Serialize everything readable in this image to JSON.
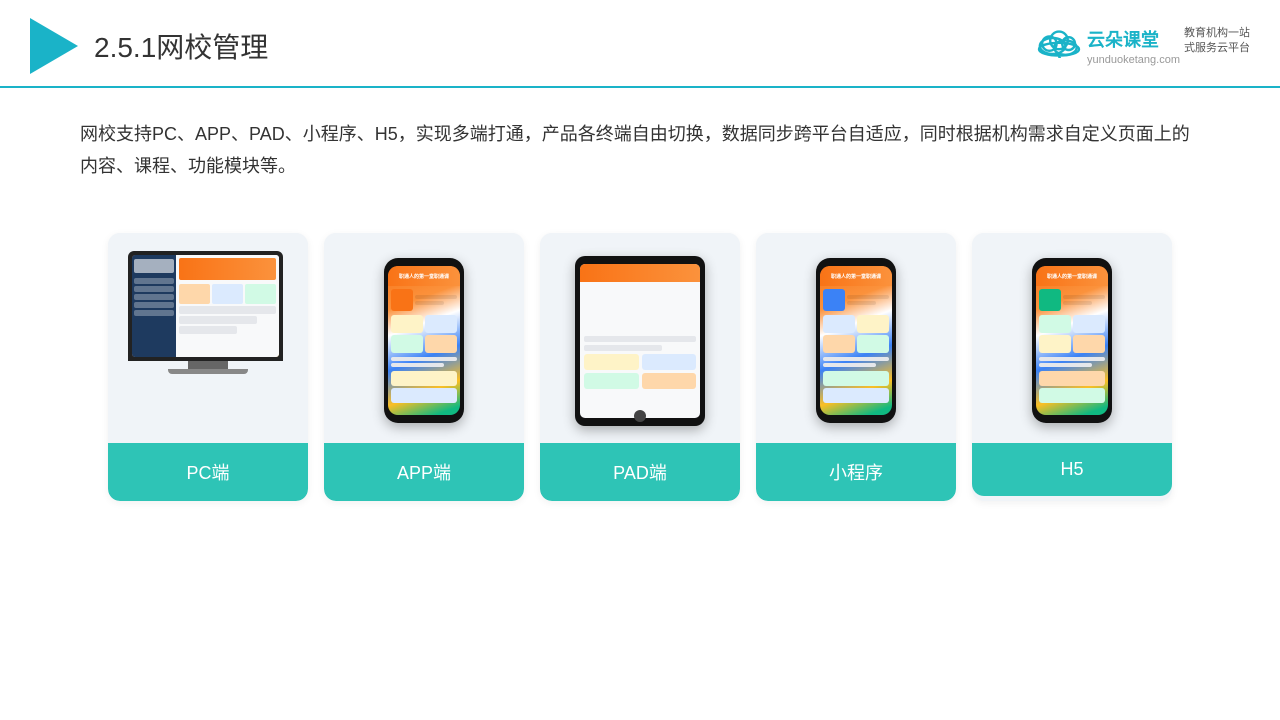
{
  "header": {
    "title_number": "2.5.1",
    "title_text": "网校管理",
    "brand_name": "云朵课堂",
    "brand_url": "yunduoketang.com",
    "brand_slogan_line1": "教育机构一站",
    "brand_slogan_line2": "式服务云平台"
  },
  "description": {
    "text": "网校支持PC、APP、PAD、小程序、H5，实现多端打通，产品各终端自由切换，数据同步跨平台自适应，同时根据机构需求自定义页面上的内容、课程、功能模块等。"
  },
  "cards": [
    {
      "id": "pc",
      "label": "PC端"
    },
    {
      "id": "app",
      "label": "APP端"
    },
    {
      "id": "pad",
      "label": "PAD端"
    },
    {
      "id": "miniprogram",
      "label": "小程序"
    },
    {
      "id": "h5",
      "label": "H5"
    }
  ]
}
